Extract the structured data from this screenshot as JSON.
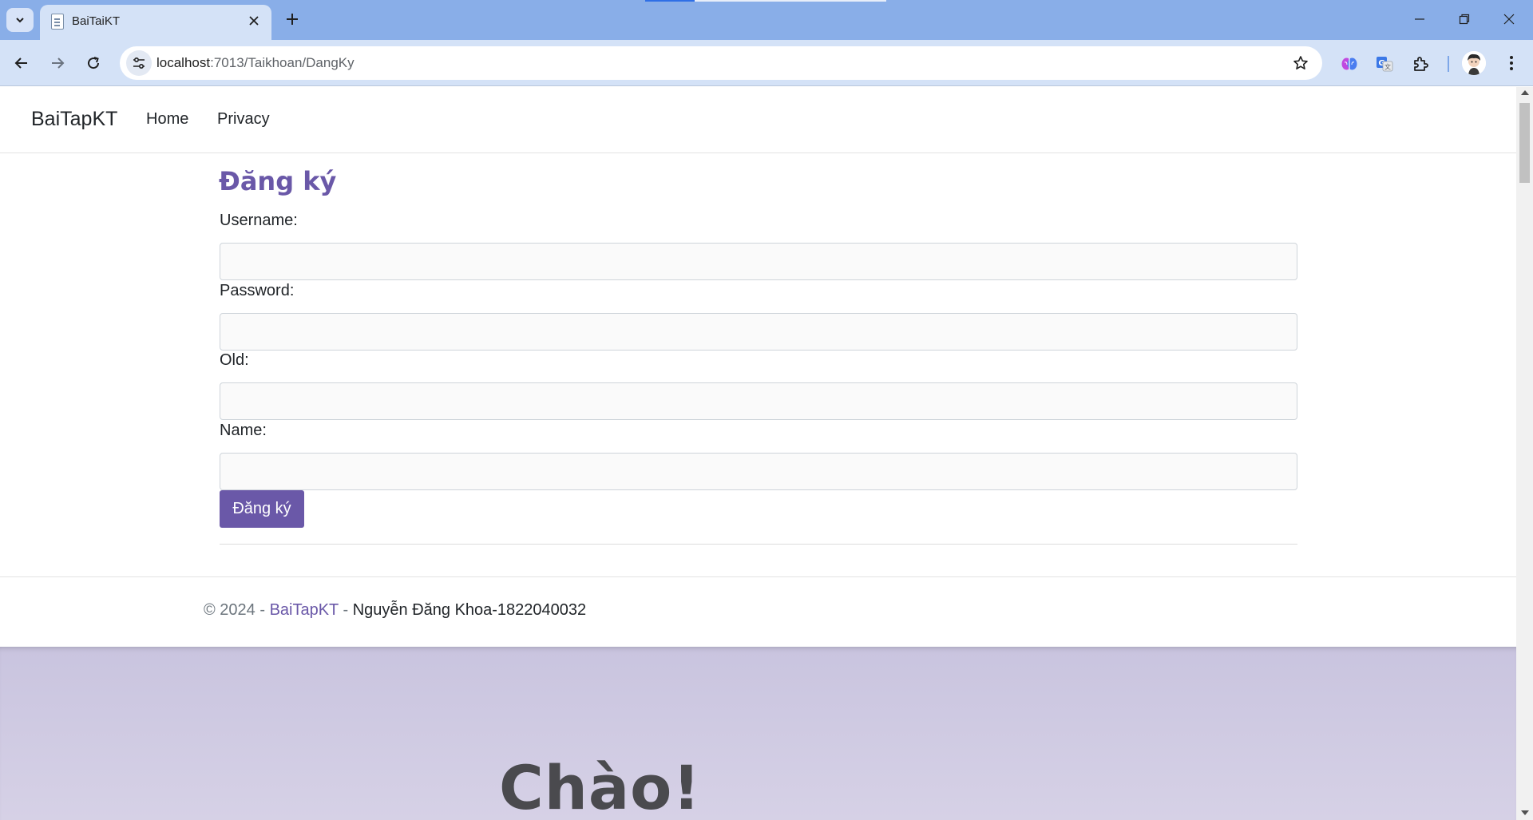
{
  "browser": {
    "tab": {
      "title": "BaiTaiKT"
    },
    "address_bar": {
      "host": "localhost",
      "path": ":7013/Taikhoan/DangKy"
    }
  },
  "site": {
    "brand": "BaiTapKT",
    "nav": [
      {
        "label": "Home"
      },
      {
        "label": "Privacy"
      }
    ]
  },
  "form": {
    "title": "Đăng ký",
    "fields": [
      {
        "label": "Username:",
        "value": ""
      },
      {
        "label": "Password:",
        "value": ""
      },
      {
        "label": "Old:",
        "value": ""
      },
      {
        "label": "Name:",
        "value": ""
      }
    ],
    "submit_label": "Đăng ký"
  },
  "footer": {
    "copyright": "© 2024 - ",
    "brand": "BaiTapKT",
    "separator": " - ",
    "author": "Nguyễn Đăng Khoa-1822040032"
  },
  "hero": {
    "title": "Chào!"
  },
  "colors": {
    "accent": "#6a58a8",
    "tabstrip": "#89aee8",
    "toolbar": "#d4e2f7",
    "hero_bg": "#cfcae3"
  },
  "icons": {
    "tab_search": "chevron-down-icon",
    "tab_favicon": "page-icon",
    "tab_close": "close-icon",
    "new_tab": "plus-icon",
    "back": "arrow-left-icon",
    "forward": "arrow-right-icon",
    "reload": "reload-icon",
    "site_info": "tune-icon",
    "bookmark": "star-icon",
    "extensions": [
      "brain-icon",
      "translate-icon",
      "puzzle-icon"
    ],
    "menu": "kebab-menu-icon"
  }
}
